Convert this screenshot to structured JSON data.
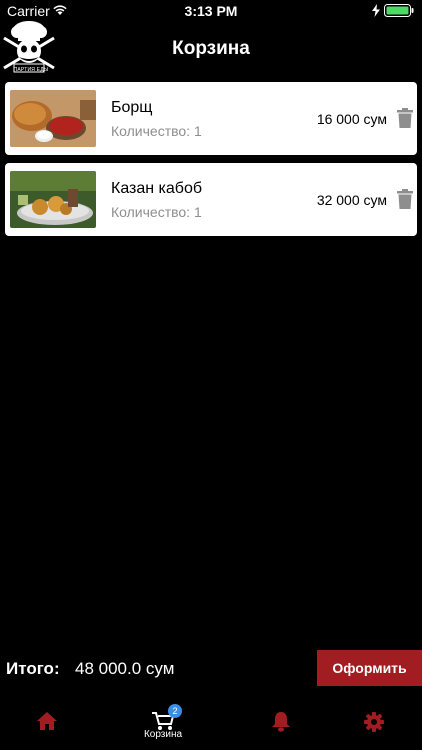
{
  "status_bar": {
    "carrier": "Carrier",
    "time": "3:13 PM"
  },
  "header": {
    "title": "Корзина",
    "logo_text": "ПАРТИЯ ЕДЫ"
  },
  "cart": {
    "items": [
      {
        "name": "Борщ",
        "quantity": "Количество: 1",
        "price": "16 000 сум"
      },
      {
        "name": "Казан кабоб",
        "quantity": "Количество: 1",
        "price": "32 000 сум"
      }
    ]
  },
  "footer": {
    "total_label": "Итого:",
    "total_value": "48 000.0 сум",
    "checkout_label": "Оформить"
  },
  "tab_bar": {
    "active_color": "#a11d21",
    "tabs": [
      {
        "icon": "home-icon",
        "label": ""
      },
      {
        "icon": "cart-icon",
        "label": "Корзина",
        "badge": "2"
      },
      {
        "icon": "bell-icon",
        "label": ""
      },
      {
        "icon": "gear-icon",
        "label": ""
      }
    ]
  }
}
